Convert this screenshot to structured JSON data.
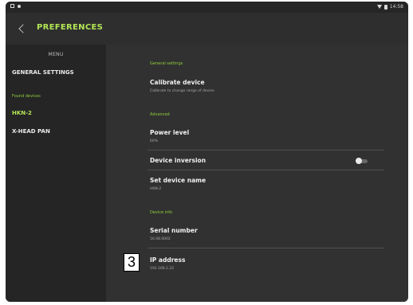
{
  "status_bar": {
    "time": "14:58"
  },
  "app_bar": {
    "title": "PREFERENCES"
  },
  "sidebar": {
    "menu_heading": "MENU",
    "general_settings": "GENERAL SETTINGS",
    "found_devices_label": "Found devices",
    "devices": [
      "HKN-2",
      "X-HEAD PAN"
    ]
  },
  "settings": {
    "general_section": "General settings",
    "calibrate_title": "Calibrate device",
    "calibrate_sub": "Calibrate to change range of device",
    "advanced_section": "Advanced",
    "power_level_title": "Power level",
    "power_level_value": "60%",
    "device_inversion_title": "Device inversion",
    "device_inversion_on": false,
    "set_name_title": "Set device name",
    "set_name_value": "HKN-2",
    "device_info_section": "Device info",
    "serial_title": "Serial number",
    "serial_value": "16.08.0002",
    "ip_title": "IP address",
    "ip_value": "192.168.2.22"
  },
  "annotation": {
    "label": "3"
  }
}
